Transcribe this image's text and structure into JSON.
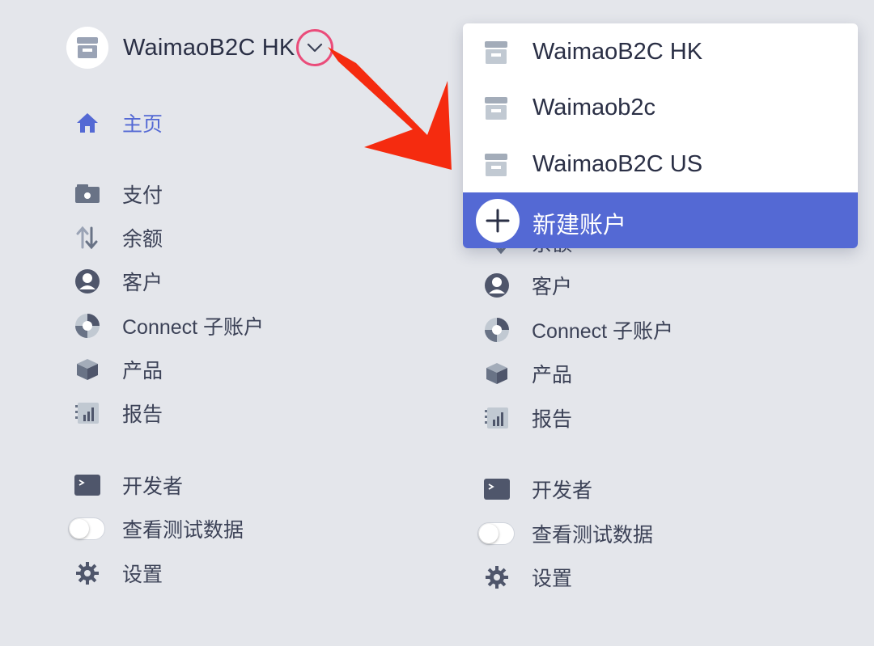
{
  "colors": {
    "accent": "#5469d4",
    "arrow": "#f52b0f",
    "highlight_circle": "#ea4c7a",
    "background": "#e4e6eb",
    "icon_gray": "#697386"
  },
  "account": {
    "name": "WaimaoB2C HK"
  },
  "nav": {
    "home": "主页",
    "payments": "支付",
    "balances": "余额",
    "customers": "客户",
    "connect": "Connect 子账户",
    "products": "产品",
    "reports": "报告",
    "developers": "开发者",
    "test_data": "查看测试数据",
    "settings": "设置",
    "test_data_enabled": false
  },
  "right_nav": {
    "balances_partial": "余额",
    "customers": "客户",
    "connect": "Connect 子账户",
    "products": "产品",
    "reports": "报告",
    "developers": "开发者",
    "test_data": "查看测试数据",
    "settings": "设置"
  },
  "dropdown": {
    "accounts": [
      "WaimaoB2C HK",
      "Waimaob2c",
      "WaimaoB2C US"
    ],
    "new_account": "新建账户"
  },
  "icons": [
    "store-icon",
    "chevron-down-icon",
    "home-icon",
    "payments-icon",
    "balances-icon",
    "customer-icon",
    "connect-icon",
    "product-icon",
    "report-icon",
    "terminal-icon",
    "toggle-switch",
    "gear-icon",
    "plus-icon"
  ]
}
